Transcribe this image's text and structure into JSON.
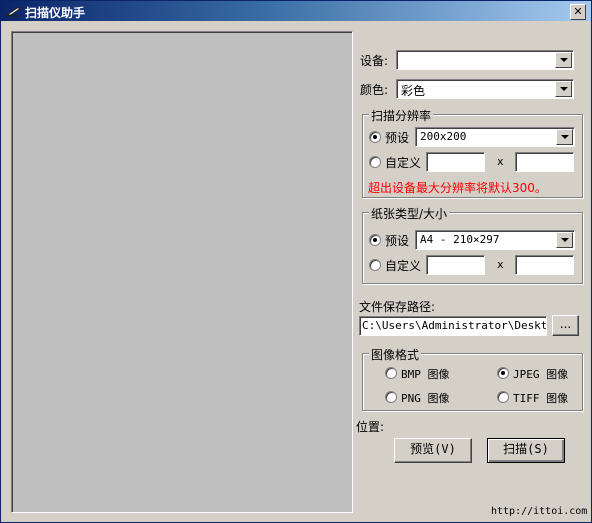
{
  "window": {
    "title": "扫描仪助手",
    "close_label": "✕"
  },
  "device": {
    "label": "设备:",
    "value": ""
  },
  "color": {
    "label": "颜色:",
    "value": "彩色"
  },
  "resolution": {
    "title": "扫描分辨率",
    "preset_label": "预设",
    "preset_value": "200x200",
    "custom_label": "自定义",
    "custom_width": "",
    "custom_height": "",
    "times": "x",
    "warning": "超出设备最大分辨率将默认300。"
  },
  "paper": {
    "title": "纸张类型/大小",
    "preset_label": "预设",
    "preset_value": "A4 - 210×297",
    "custom_label": "自定义",
    "custom_width": "",
    "custom_height": "",
    "times": "x"
  },
  "save_path": {
    "label": "文件保存路径:",
    "value": "C:\\Users\\Administrator\\Desktop",
    "browse_label": "..."
  },
  "image_format": {
    "title": "图像格式",
    "options": [
      "BMP 图像",
      "JPEG 图像",
      "PNG 图像",
      "TIFF 图像"
    ],
    "selected": "JPEG 图像"
  },
  "position_label": "位置:",
  "buttons": {
    "preview": "预览(V)",
    "scan": "扫描(S)"
  },
  "footer": "http://ittoi.com"
}
